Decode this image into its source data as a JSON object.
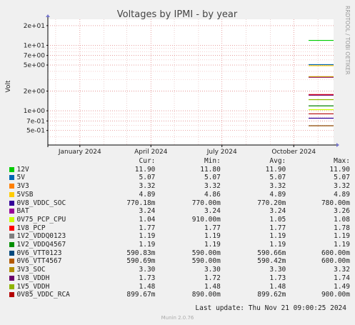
{
  "chart_data": {
    "type": "line",
    "title": "Voltages by IPMI - by year",
    "ylabel": "Volt",
    "y_scale": "log",
    "ylim": [
      0.3,
      25
    ],
    "y_ticks": [
      {
        "value": 20,
        "label": "2e+01"
      },
      {
        "value": 10,
        "label": "1e+01"
      },
      {
        "value": 7,
        "label": "7e+00"
      },
      {
        "value": 5,
        "label": "5e+00"
      },
      {
        "value": 2,
        "label": "2e+00"
      },
      {
        "value": 1,
        "label": "1e+00"
      },
      {
        "value": 0.7,
        "label": "7e-01"
      },
      {
        "value": 0.5,
        "label": "5e-01"
      }
    ],
    "x_range": [
      "2023-11-21",
      "2024-11-21"
    ],
    "x_ticks": [
      {
        "date": "2024-01-01",
        "label": "January 2024"
      },
      {
        "date": "2024-04-01",
        "label": "April 2024"
      },
      {
        "date": "2024-07-01",
        "label": "July 2024"
      },
      {
        "date": "2024-10-01",
        "label": "October 2024"
      }
    ],
    "data_start": "2024-10-20",
    "grid": true,
    "legend_columns": [
      "Cur:",
      "Min:",
      "Avg:",
      "Max:"
    ],
    "series": [
      {
        "name": "12V",
        "color": "#00cc00",
        "value": 11.9,
        "cur": "11.90",
        "min": "11.80",
        "avg": "11.90",
        "max": "11.90"
      },
      {
        "name": "5V",
        "color": "#0066b3",
        "value": 5.07,
        "cur": "5.07",
        "min": "5.07",
        "avg": "5.07",
        "max": "5.07"
      },
      {
        "name": "3V3",
        "color": "#ff8000",
        "value": 3.32,
        "cur": "3.32",
        "min": "3.32",
        "avg": "3.32",
        "max": "3.32"
      },
      {
        "name": "5VSB",
        "color": "#ffcc00",
        "value": 4.89,
        "cur": "4.89",
        "min": "4.86",
        "avg": "4.89",
        "max": "4.89"
      },
      {
        "name": "0V8_VDDC_SOC",
        "color": "#330099",
        "value": 0.77018,
        "cur": "770.18m",
        "min": "770.00m",
        "avg": "770.20m",
        "max": "780.00m"
      },
      {
        "name": "BAT",
        "color": "#990099",
        "value": 3.24,
        "cur": "3.24",
        "min": "3.24",
        "avg": "3.24",
        "max": "3.26"
      },
      {
        "name": "0V75_PCP_CPU",
        "color": "#ccff00",
        "value": 1.04,
        "cur": "1.04",
        "min": "910.00m",
        "avg": "1.05",
        "max": "1.08"
      },
      {
        "name": "1V8_PCP",
        "color": "#ff0000",
        "value": 1.77,
        "cur": "1.77",
        "min": "1.77",
        "avg": "1.77",
        "max": "1.78"
      },
      {
        "name": "1V2_VDDQ0123",
        "color": "#808080",
        "value": 1.19,
        "cur": "1.19",
        "min": "1.19",
        "avg": "1.19",
        "max": "1.19"
      },
      {
        "name": "1V2_VDDQ4567",
        "color": "#008f00",
        "value": 1.19,
        "cur": "1.19",
        "min": "1.19",
        "avg": "1.19",
        "max": "1.19"
      },
      {
        "name": "0V6_VTT0123",
        "color": "#00487d",
        "value": 0.59083,
        "cur": "590.83m",
        "min": "590.00m",
        "avg": "590.66m",
        "max": "600.00m"
      },
      {
        "name": "0V6_VTT4567",
        "color": "#b35a00",
        "value": 0.59069,
        "cur": "590.69m",
        "min": "590.00m",
        "avg": "590.42m",
        "max": "600.00m"
      },
      {
        "name": "3V3_SOC",
        "color": "#b38f00",
        "value": 3.3,
        "cur": "3.30",
        "min": "3.30",
        "avg": "3.30",
        "max": "3.32"
      },
      {
        "name": "1V8_VDDH",
        "color": "#6b006b",
        "value": 1.73,
        "cur": "1.73",
        "min": "1.72",
        "avg": "1.73",
        "max": "1.74"
      },
      {
        "name": "1V5_VDDH",
        "color": "#8fb300",
        "value": 1.48,
        "cur": "1.48",
        "min": "1.48",
        "avg": "1.48",
        "max": "1.49"
      },
      {
        "name": "0V85_VDDC_RCA",
        "color": "#b30000",
        "value": 0.89967,
        "cur": "899.67m",
        "min": "890.00m",
        "avg": "899.62m",
        "max": "900.00m"
      }
    ]
  },
  "side_label": "RRDTOOL / TOBI OETIKER",
  "last_update": "Last update: Thu Nov 21 09:00:25 2024",
  "footer": "Munin 2.0.76"
}
